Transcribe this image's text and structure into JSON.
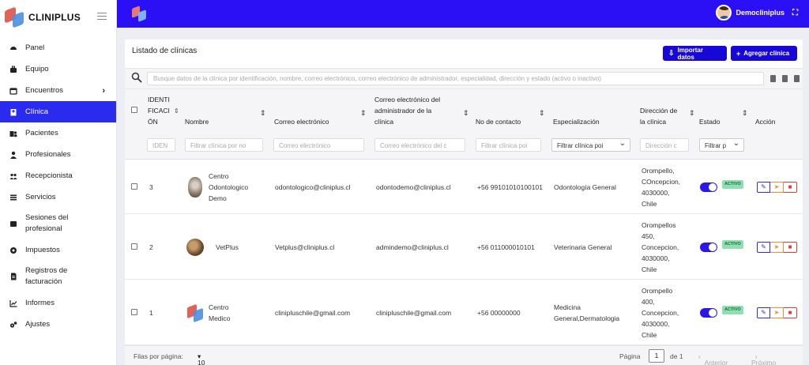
{
  "brand": {
    "name": "CLINIPLUS"
  },
  "sidebar": {
    "items": [
      {
        "label": "Panel",
        "icon": "gauge-icon"
      },
      {
        "label": "Equipo",
        "icon": "briefcase-icon"
      },
      {
        "label": "Encuentros",
        "icon": "calendar-icon",
        "has_submenu": true
      },
      {
        "label": "Clínica",
        "icon": "hospital-icon",
        "active": true
      },
      {
        "label": "Pacientes",
        "icon": "hospital-user-icon"
      },
      {
        "label": "Profesionales",
        "icon": "user-doctor-icon"
      },
      {
        "label": "Recepcionista",
        "icon": "users-icon"
      },
      {
        "label": "Servicios",
        "icon": "list-icon"
      },
      {
        "label": "Sesiones del profesional",
        "icon": "calendar-check-icon"
      },
      {
        "label": "Impuestos",
        "icon": "coin-icon"
      },
      {
        "label": "Registros de facturación",
        "icon": "invoice-icon"
      },
      {
        "label": "Informes",
        "icon": "chart-line-icon"
      },
      {
        "label": "Ajustes",
        "icon": "cogs-icon"
      }
    ]
  },
  "topbar": {
    "user_name": "Democliniplus"
  },
  "page": {
    "title": "Listado de clínicas",
    "import_label": "Importar datos",
    "add_label": "Agregar clínica",
    "search_placeholder": "Busque datos de la clínica por identificación, nombre, correo electrónico, correo electrónico de administrador, especialidad, dirección y estado (activo o inactivo)"
  },
  "table": {
    "headers": {
      "id": [
        "IDENTI",
        "FICACI",
        "ÓN"
      ],
      "name": "Nombre",
      "email": "Correo electrónico",
      "admin_email": [
        "Correo electrónico del",
        "administrador de la",
        "clínica"
      ],
      "contact": "No de contacto",
      "specialization": "Especialización",
      "address": [
        "Dirección de",
        "la clínica"
      ],
      "status": "Estado",
      "action": "Acción"
    },
    "filters": {
      "id": "IDEN",
      "name": "Filtrar clínica por no",
      "email": "Correo electrónico",
      "admin_email": "Correo electrónico del c",
      "contact": "Filtrar clínica poi",
      "specialization": "Filtrar clínica poi",
      "address": "Dirección c",
      "status": "Filtrar p"
    },
    "rows": [
      {
        "id": "3",
        "name": [
          "Centro",
          "Odontologico",
          "Demo"
        ],
        "email": "odontologico@cliniplus.cl",
        "admin_email": "odontodemo@cliniplus.cl",
        "contact": "+56 99101010100101",
        "specialization": [
          "Odontología General"
        ],
        "address": [
          "Orompello,",
          "COncepcion,",
          "4030000,",
          "Chile"
        ],
        "status": "ACTIVO"
      },
      {
        "id": "2",
        "name": [
          "VetPlus"
        ],
        "email": "Vetplus@cliniplus.cl",
        "admin_email": "admindemo@cliniplus.cl",
        "contact": "+56 011000010101",
        "specialization": [
          "Veterinaria General"
        ],
        "address": [
          "Orompellos",
          "450,",
          "Concepcion,",
          "4030000,",
          "Chile"
        ],
        "status": "ACTIVO"
      },
      {
        "id": "1",
        "name": [
          "Centro",
          "Medico"
        ],
        "email": "clinipluschile@gmail.com",
        "admin_email": "clinipluschile@gmail.com",
        "contact": "+56 00000000",
        "specialization": [
          "Medicina",
          "General,Dermatologia"
        ],
        "address": [
          "Orompello",
          "400,",
          "Concepcion,",
          "4030000,",
          "Chile"
        ],
        "status": "ACTIVO"
      }
    ]
  },
  "footer": {
    "rows_per_page_label": "Filas por página:",
    "rows_per_page_value": "10",
    "page_label": "Página",
    "page_value": "1",
    "of_label": "de 1",
    "prev_label": "Anterior",
    "next_label": "Próximo"
  },
  "colors": {
    "primary": "#2b10f5",
    "button": "#1808d8",
    "active_badge": "#8ee0b0"
  }
}
